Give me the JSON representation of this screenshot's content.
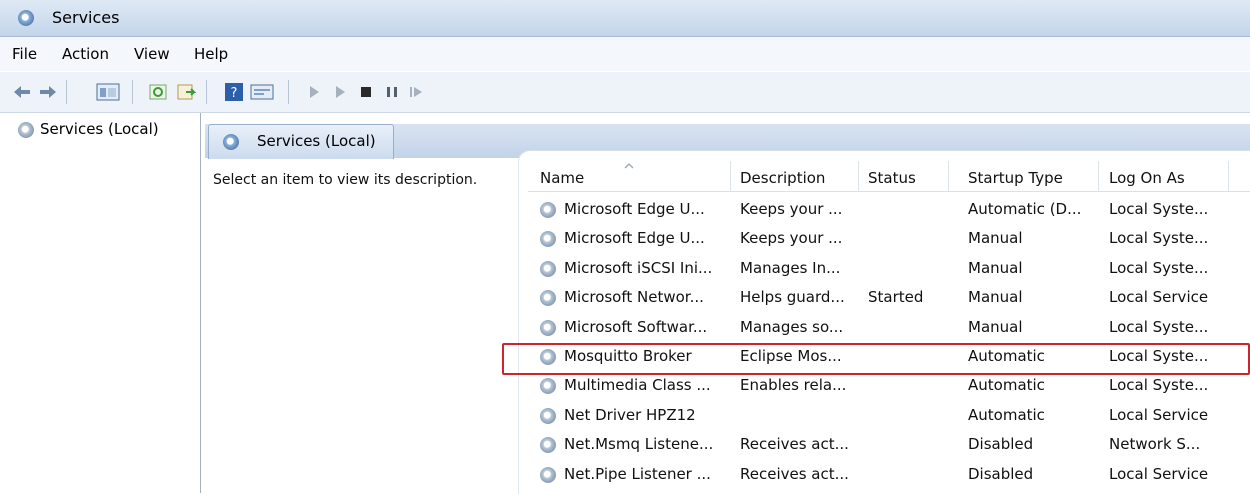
{
  "window": {
    "title": "Services"
  },
  "menu": [
    "File",
    "Action",
    "View",
    "Help"
  ],
  "toolbar": {
    "icons": [
      "back-arrow-icon",
      "forward-arrow-icon",
      "show-hide-tree-icon",
      "refresh-icon",
      "export-list-icon",
      "help-icon",
      "properties-icon",
      "start-service-icon",
      "start-service-alt-icon",
      "stop-service-icon",
      "pause-service-icon",
      "restart-service-icon"
    ]
  },
  "tree": {
    "root_label": "Services (Local)"
  },
  "pane": {
    "tab_label": "Services (Local)",
    "description_hint": "Select an item to view its description."
  },
  "table": {
    "columns": [
      "Name",
      "Description",
      "Status",
      "Startup Type",
      "Log On As"
    ],
    "rows": [
      {
        "name": "Microsoft Edge U...",
        "description": "Keeps your ...",
        "status": "",
        "startup": "Automatic (D...",
        "logon": "Local Syste..."
      },
      {
        "name": "Microsoft Edge U...",
        "description": "Keeps your ...",
        "status": "",
        "startup": "Manual",
        "logon": "Local Syste..."
      },
      {
        "name": "Microsoft iSCSI Ini...",
        "description": "Manages In...",
        "status": "",
        "startup": "Manual",
        "logon": "Local Syste..."
      },
      {
        "name": "Microsoft Networ...",
        "description": "Helps guard...",
        "status": "Started",
        "startup": "Manual",
        "logon": "Local Service"
      },
      {
        "name": "Microsoft Softwar...",
        "description": "Manages so...",
        "status": "",
        "startup": "Manual",
        "logon": "Local Syste..."
      },
      {
        "name": "Mosquitto Broker",
        "description": "Eclipse Mos...",
        "status": "",
        "startup": "Automatic",
        "logon": "Local Syste..."
      },
      {
        "name": "Multimedia Class ...",
        "description": "Enables rela...",
        "status": "",
        "startup": "Automatic",
        "logon": "Local Syste..."
      },
      {
        "name": "Net Driver HPZ12",
        "description": "",
        "status": "",
        "startup": "Automatic",
        "logon": "Local Service"
      },
      {
        "name": "Net.Msmq Listene...",
        "description": "Receives act...",
        "status": "",
        "startup": "Disabled",
        "logon": "Network S..."
      },
      {
        "name": "Net.Pipe Listener ...",
        "description": "Receives act...",
        "status": "",
        "startup": "Disabled",
        "logon": "Local Service"
      }
    ],
    "highlighted_row_index": 5,
    "highlight_color": "#d2232a"
  }
}
